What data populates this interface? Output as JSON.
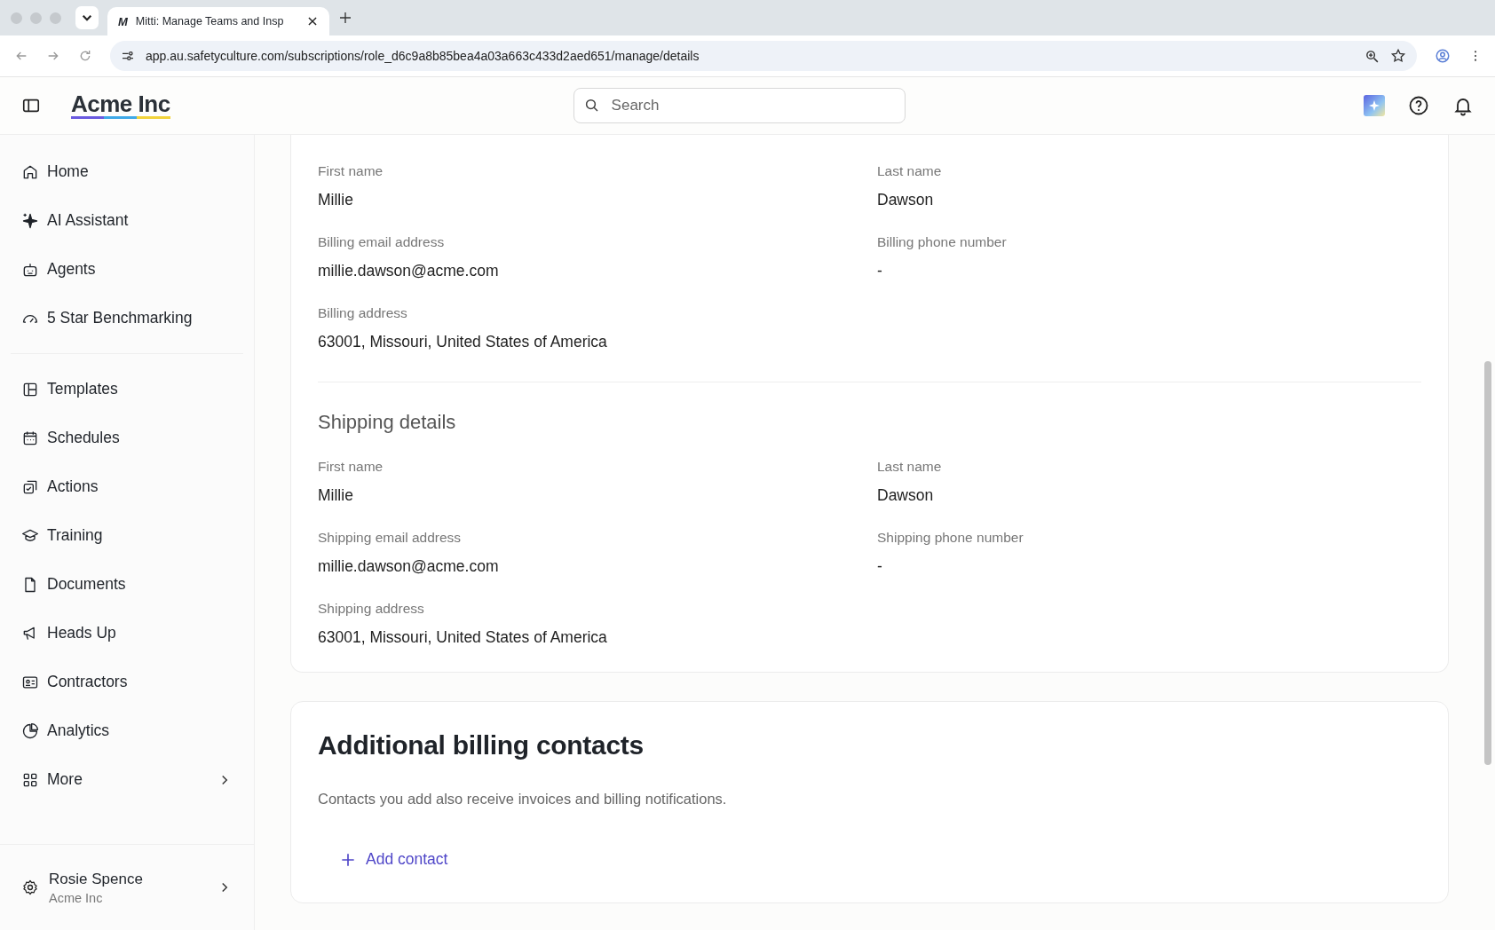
{
  "browser": {
    "tab_title": "Mitti: Manage Teams and Insp",
    "tab_logo": "M",
    "url": "app.au.safetyculture.com/subscriptions/role_d6c9a8b85bea4a03a663c433d2aed651/manage/details"
  },
  "header": {
    "brand": "Acme Inc",
    "search": {
      "placeholder": "Search"
    }
  },
  "sidebar": {
    "groups": [
      [
        {
          "label": "Home"
        },
        {
          "label": "AI Assistant"
        },
        {
          "label": "Agents"
        },
        {
          "label": "5 Star Benchmarking"
        }
      ],
      [
        {
          "label": "Templates"
        },
        {
          "label": "Schedules"
        },
        {
          "label": "Actions"
        },
        {
          "label": "Training"
        },
        {
          "label": "Documents"
        },
        {
          "label": "Heads Up"
        },
        {
          "label": "Contractors"
        },
        {
          "label": "Analytics"
        },
        {
          "label": "More"
        }
      ]
    ],
    "user": {
      "name": "Rosie Spence",
      "org": "Acme Inc"
    }
  },
  "billing": {
    "fields": [
      {
        "label": "First name",
        "value": "Millie"
      },
      {
        "label": "Last name",
        "value": "Dawson"
      },
      {
        "label": "Billing email address",
        "value": "millie.dawson@acme.com"
      },
      {
        "label": "Billing phone number",
        "value": "-"
      },
      {
        "label": "Billing address",
        "value": "63001, Missouri, United States of America"
      }
    ]
  },
  "shipping": {
    "title": "Shipping details",
    "fields": [
      {
        "label": "First name",
        "value": "Millie"
      },
      {
        "label": "Last name",
        "value": "Dawson"
      },
      {
        "label": "Shipping email address",
        "value": "millie.dawson@acme.com"
      },
      {
        "label": "Shipping phone number",
        "value": "-"
      },
      {
        "label": "Shipping address",
        "value": "63001, Missouri, United States of America"
      }
    ]
  },
  "contacts": {
    "title": "Additional billing contacts",
    "description": "Contacts you add also receive invoices and billing notifications.",
    "add_button": "Add contact"
  }
}
